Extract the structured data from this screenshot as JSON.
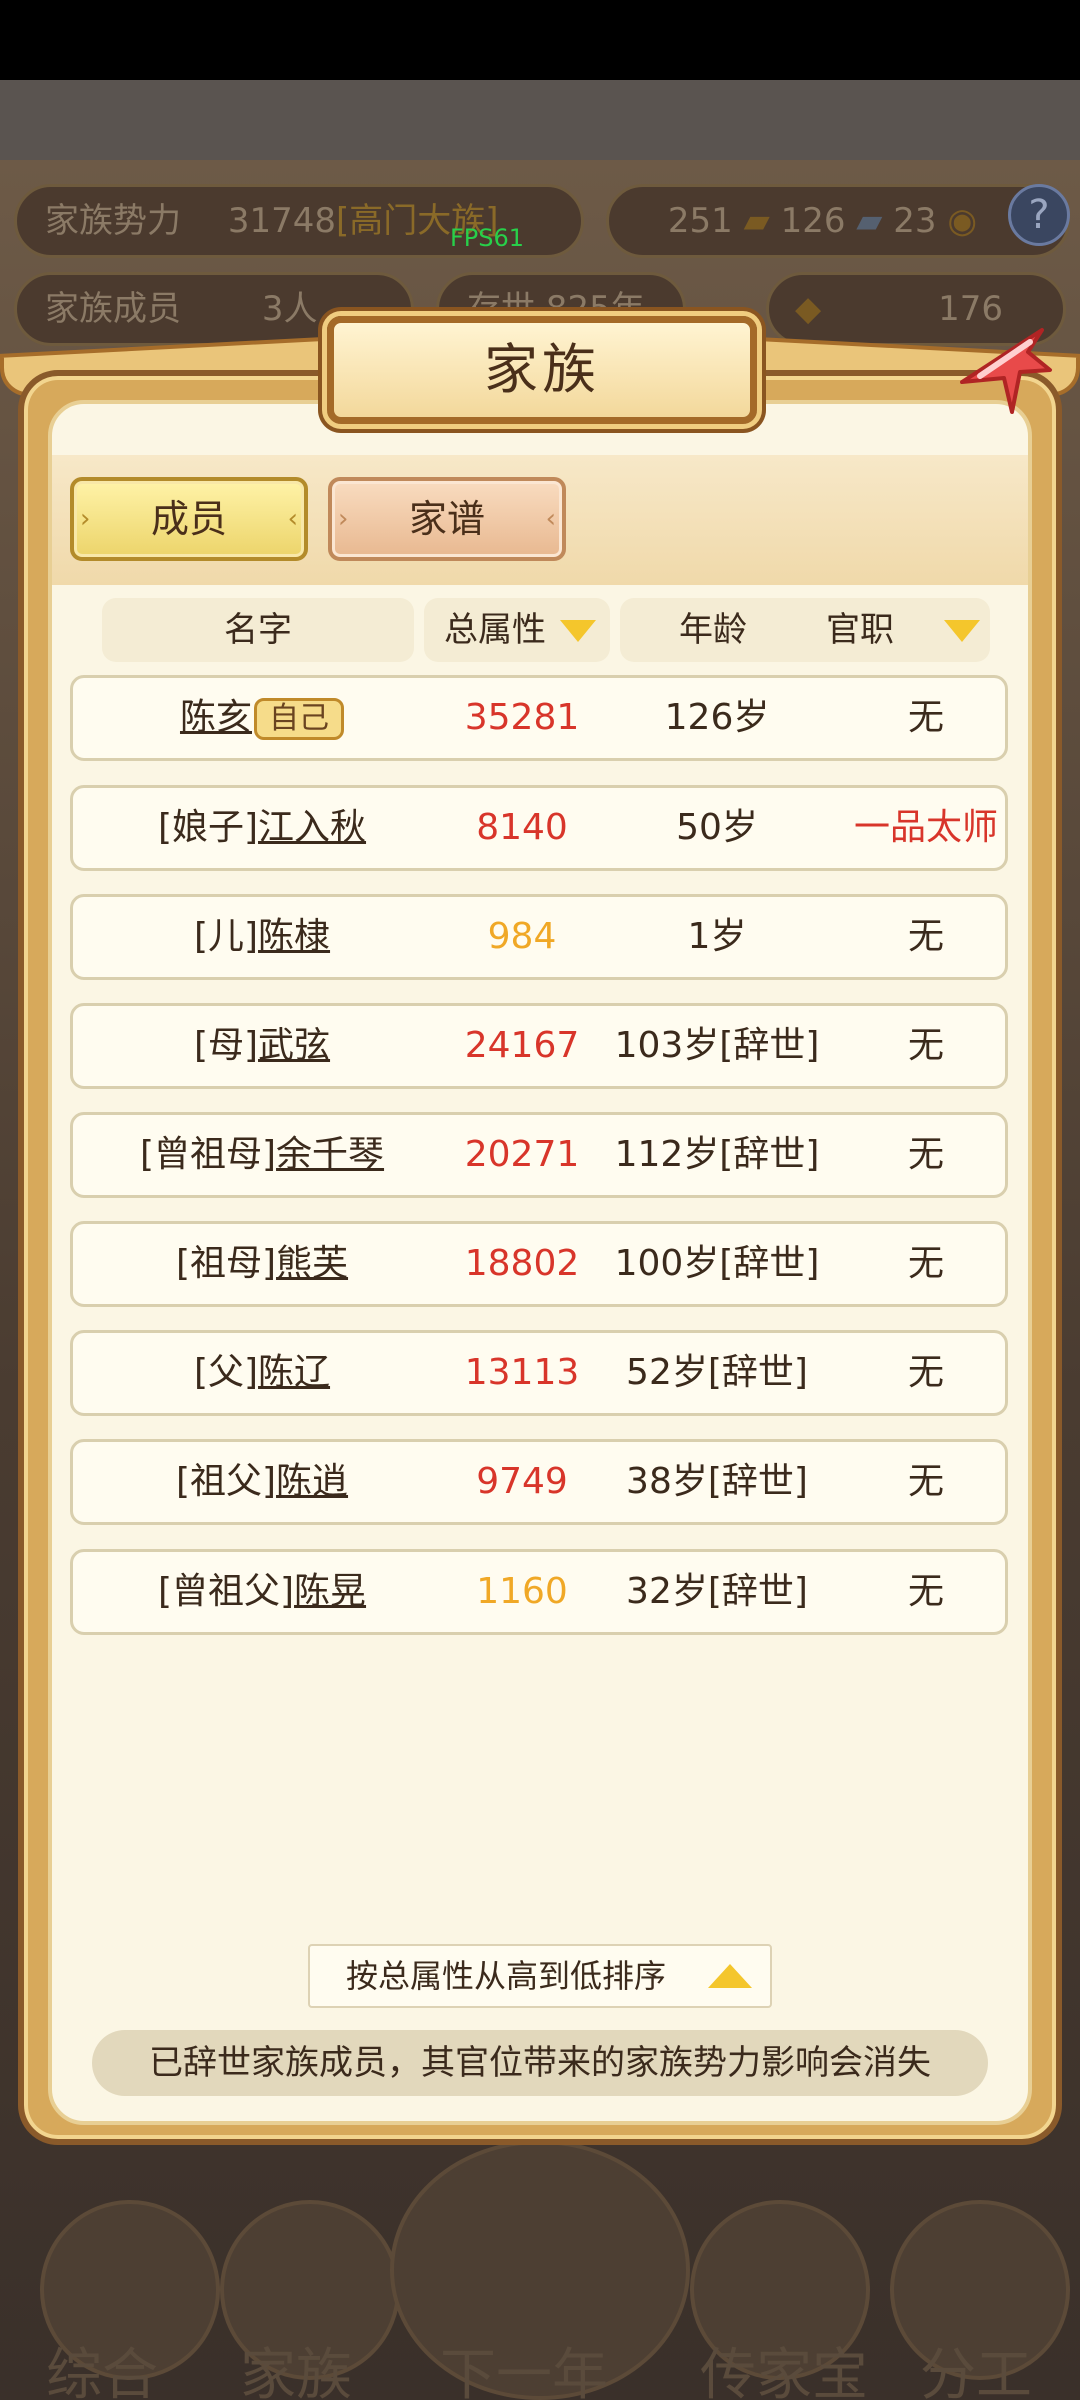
{
  "background": {
    "fps": "FPS61",
    "power_label": "家族势力",
    "power_value": "31748",
    "power_rank": "[高门大族]",
    "res_1": "251",
    "res_2": "126",
    "res_3": "23",
    "members_label": "家族成员",
    "members_count": "3人",
    "survival": "存世 825年",
    "gold": "176",
    "nav": [
      "综合",
      "家族",
      "下一年",
      "传家宝",
      "分工"
    ]
  },
  "modal": {
    "title": "家族",
    "tabs": {
      "members": "成员",
      "genealogy": "家谱"
    },
    "headers": {
      "name": "名字",
      "total": "总属性",
      "age": "年龄",
      "title": "官职"
    },
    "rows": [
      {
        "relation": "",
        "name": "陈亥",
        "badge": "自己",
        "total": "35281",
        "total_color": "red",
        "age": "126岁",
        "title": "无",
        "title_color": ""
      },
      {
        "relation": "[娘子]",
        "name": "江入秋",
        "badge": "",
        "total": "8140",
        "total_color": "red",
        "age": "50岁",
        "title": "一品太师",
        "title_color": "red"
      },
      {
        "relation": "[儿]",
        "name": "陈棣",
        "badge": "",
        "total": "984",
        "total_color": "orange",
        "age": "1岁",
        "title": "无",
        "title_color": ""
      },
      {
        "relation": "[母]",
        "name": "武弦",
        "badge": "",
        "total": "24167",
        "total_color": "red",
        "age": "103岁[辞世]",
        "title": "无",
        "title_color": ""
      },
      {
        "relation": "[曾祖母]",
        "name": "余千琴",
        "badge": "",
        "total": "20271",
        "total_color": "red",
        "age": "112岁[辞世]",
        "title": "无",
        "title_color": ""
      },
      {
        "relation": "[祖母]",
        "name": "熊芙",
        "badge": "",
        "total": "18802",
        "total_color": "red",
        "age": "100岁[辞世]",
        "title": "无",
        "title_color": ""
      },
      {
        "relation": "[父]",
        "name": "陈辽",
        "badge": "",
        "total": "13113",
        "total_color": "red",
        "age": "52岁[辞世]",
        "title": "无",
        "title_color": ""
      },
      {
        "relation": "[祖父]",
        "name": "陈逍",
        "badge": "",
        "total": "9749",
        "total_color": "red",
        "age": "38岁[辞世]",
        "title": "无",
        "title_color": ""
      },
      {
        "relation": "[曾祖父]",
        "name": "陈晃",
        "badge": "",
        "total": "1160",
        "total_color": "orange",
        "age": "32岁[辞世]",
        "title": "无",
        "title_color": ""
      }
    ],
    "sort_label": "按总属性从高到低排序",
    "notice": "已辞世家族成员，其官位带来的家族势力影响会消失"
  },
  "colors": {
    "red": "#d8352a",
    "orange": "#f0a826",
    "gold": "#f4c62c"
  }
}
